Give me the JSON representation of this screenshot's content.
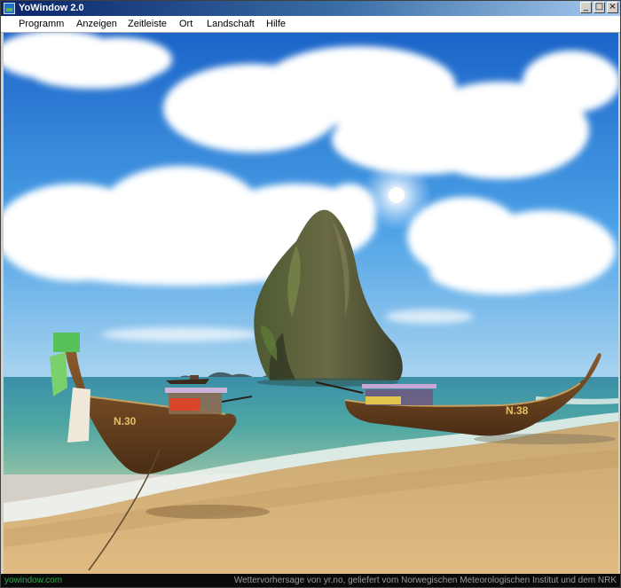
{
  "window": {
    "title": "YoWindow 2.0",
    "controls": {
      "minimize": "_",
      "maximize": "□",
      "close": "×"
    }
  },
  "menu": {
    "items": [
      "Programm",
      "Anzeigen",
      "Zeitleiste",
      "Ort",
      "Landschaft",
      "Hilfe"
    ]
  },
  "scene": {
    "boat_left_label": "N.30",
    "boat_right_label": "N.38"
  },
  "status": {
    "site": "yowindow.com",
    "credit": "Wettervorhersage von yr.no, geliefert vom Norwegischen Meteorologischen Institut und dem NRK"
  },
  "colors": {
    "titlebar": "#0a246a",
    "status_site": "#2aa84a",
    "sky_top": "#1f6fd0",
    "sea": "#2e8fa0",
    "sand": "#d9b57c"
  }
}
